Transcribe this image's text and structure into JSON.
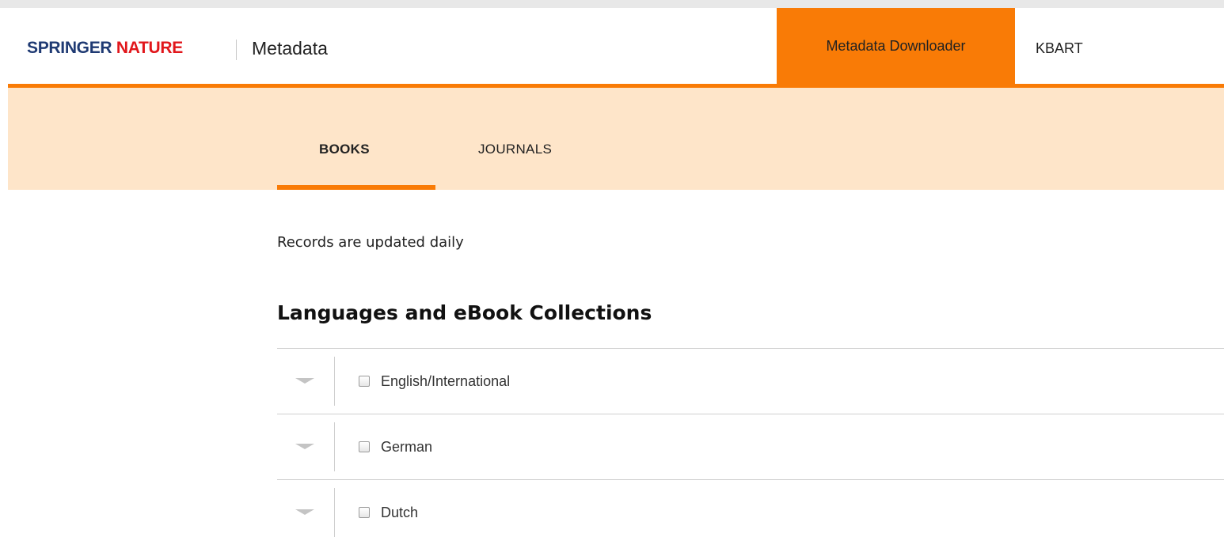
{
  "header": {
    "logo_part1": "SPRINGER",
    "logo_part2": "NATURE",
    "site_name": "Metadata",
    "nav": [
      {
        "label": "Metadata Downloader",
        "active": true
      },
      {
        "label": "KBART",
        "active": false
      }
    ]
  },
  "tabs": [
    {
      "label": "BOOKS",
      "active": true
    },
    {
      "label": "JOURNALS",
      "active": false
    }
  ],
  "main": {
    "info_text": "Records are updated daily",
    "section_title": "Languages and eBook Collections",
    "collections": [
      {
        "label": "English/International",
        "checked": false,
        "expanded": false
      },
      {
        "label": "German",
        "checked": false,
        "expanded": false
      },
      {
        "label": "Dutch",
        "checked": false,
        "expanded": false
      }
    ]
  },
  "colors": {
    "accent_orange": "#f97b06",
    "subnav_background": "#fee5c9",
    "logo_blue": "#1f3a73",
    "logo_red": "#e1161b"
  },
  "icons": [
    "chevron-down-icon",
    "checkbox-icon"
  ]
}
